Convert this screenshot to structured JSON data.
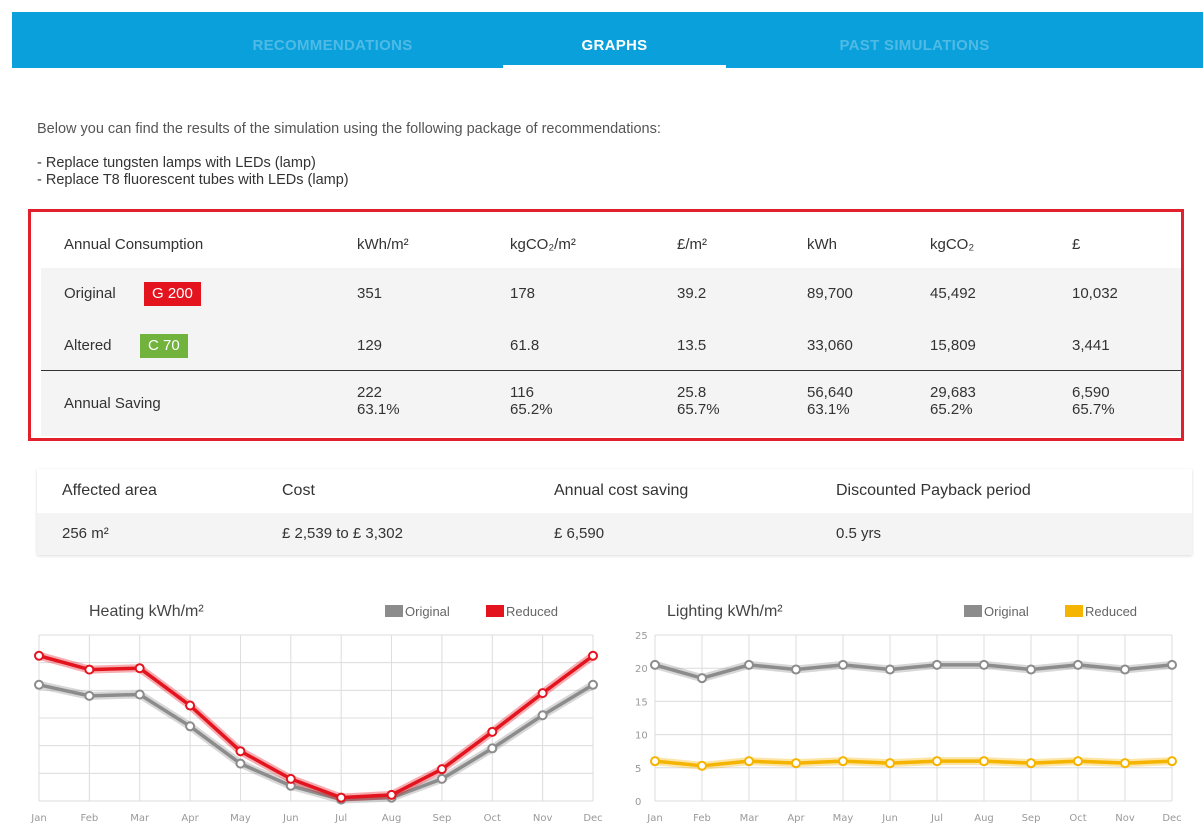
{
  "nav": {
    "tabs": [
      {
        "label": "RECOMMENDATIONS"
      },
      {
        "label": "GRAPHS"
      },
      {
        "label": "PAST SIMULATIONS"
      }
    ]
  },
  "intro": "Below you can find the results of the simulation using the following package of recommendations:",
  "recommendations": [
    "- Replace tungsten lamps with LEDs (lamp)",
    "- Replace T8 fluorescent tubes with LEDs (lamp)"
  ],
  "consumption": {
    "headers": [
      "Annual Consumption",
      "kWh/m²",
      "kgCO₂/m²",
      "£/m²",
      "kWh",
      "kgCO₂",
      "£"
    ],
    "original": {
      "label": "Original",
      "badge": "G 200",
      "values": [
        "351",
        "178",
        "39.2",
        "89,700",
        "45,492",
        "10,032"
      ]
    },
    "altered": {
      "label": "Altered",
      "badge": "C 70",
      "values": [
        "129",
        "61.8",
        "13.5",
        "33,060",
        "15,809",
        "3,441"
      ]
    },
    "saving": {
      "label": "Annual Saving",
      "values": [
        "222",
        "116",
        "25.8",
        "56,640",
        "29,683",
        "6,590"
      ],
      "percents": [
        "63.1%",
        "65.2%",
        "65.7%",
        "63.1%",
        "65.2%",
        "65.7%"
      ]
    },
    "colors": {
      "badge_red": "#e4141f",
      "badge_green": "#71b33c",
      "highlight_border": "#e0202a"
    }
  },
  "summary": {
    "headers": [
      "Affected area",
      "Cost",
      "Annual cost saving",
      "Discounted Payback period"
    ],
    "values": [
      "256 m²",
      "£ 2,539 to £ 3,302",
      "£ 6,590",
      "0.5 yrs"
    ]
  },
  "chart_data": [
    {
      "type": "line",
      "title": "Heating kWh/m²",
      "x": [
        "Jan",
        "Feb",
        "Mar",
        "Apr",
        "May",
        "Jun",
        "Jul",
        "Aug",
        "Sep",
        "Oct",
        "Nov",
        "Dec"
      ],
      "ylim": [
        0,
        6
      ],
      "yticks": [
        0,
        1,
        2,
        3,
        4,
        5,
        6
      ],
      "grid": true,
      "legend": "top-right",
      "series": [
        {
          "name": "Original",
          "color": "#8c8c8c",
          "values": [
            4.2,
            3.8,
            3.85,
            2.7,
            1.35,
            0.55,
            0.05,
            0.12,
            0.8,
            1.9,
            3.1,
            4.2
          ]
        },
        {
          "name": "Reduced",
          "color": "#e4141f",
          "values": [
            5.25,
            4.75,
            4.8,
            3.45,
            1.8,
            0.8,
            0.12,
            0.22,
            1.15,
            2.5,
            3.9,
            5.25
          ]
        }
      ]
    },
    {
      "type": "line",
      "title": "Lighting kWh/m²",
      "x": [
        "Jan",
        "Feb",
        "Mar",
        "Apr",
        "May",
        "Jun",
        "Jul",
        "Aug",
        "Sep",
        "Oct",
        "Nov",
        "Dec"
      ],
      "ylim": [
        0,
        25
      ],
      "yticks": [
        0,
        5,
        10,
        15,
        20,
        25
      ],
      "grid": true,
      "legend": "top-right",
      "series": [
        {
          "name": "Original",
          "color": "#8c8c8c",
          "values": [
            20.5,
            18.5,
            20.5,
            19.8,
            20.5,
            19.8,
            20.5,
            20.5,
            19.8,
            20.5,
            19.8,
            20.5
          ]
        },
        {
          "name": "Reduced",
          "color": "#f5b400",
          "values": [
            6.0,
            5.3,
            6.0,
            5.7,
            6.0,
            5.7,
            6.0,
            6.0,
            5.7,
            6.0,
            5.7,
            6.0
          ]
        }
      ]
    }
  ]
}
